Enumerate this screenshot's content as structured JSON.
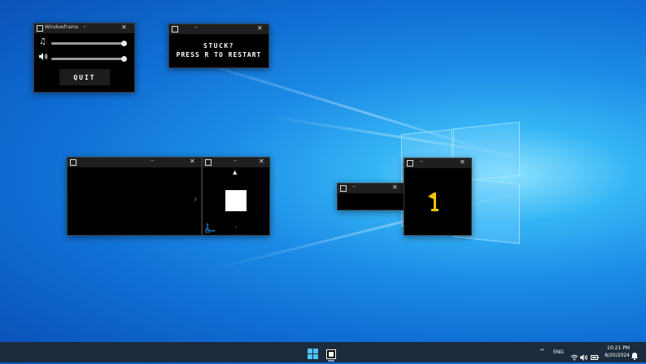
{
  "colors": {
    "accent_blue": "#1e7ed8",
    "flag_yellow": "#f2c200",
    "window_bg": "#000000",
    "titlebar_bg": "#1f1f1f",
    "taskbar_bg": "#1b2a3c"
  },
  "settings_window": {
    "title": "Windowframe",
    "min_glyph": "–",
    "close_glyph": "✕",
    "music_icon": "music-note-icon",
    "volume_icon": "speaker-icon",
    "music_volume": 1.0,
    "sfx_volume": 1.0,
    "quit_label": "QUIT"
  },
  "hint_window": {
    "line1": "STUCK?",
    "line2": "PRESS R TO RESTART"
  },
  "big_window": {
    "arrow_glyph": "›"
  },
  "player_window": {
    "up_glyph": "▲",
    "down_glyph": "⌄"
  },
  "goal_window": {
    "flag_icon": "goal-flag-icon"
  },
  "taskbar": {
    "start_icon": "windows-logo-icon",
    "app_icon": "game-app-icon",
    "chevron": "^",
    "lang": "ENG",
    "time": "10:21 PM",
    "date": "8/20/2024"
  }
}
